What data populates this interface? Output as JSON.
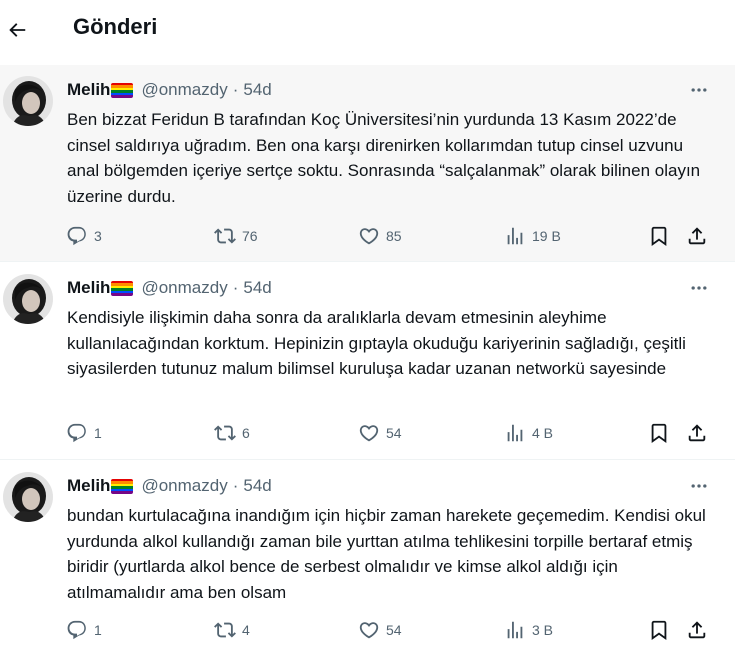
{
  "header": {
    "title": "Gönderi",
    "back_icon": "arrow-left-icon"
  },
  "colors": {
    "text": "#0f1419",
    "muted": "#536471",
    "highlight_bg": "#f7f7f7",
    "divider": "#eff3f4"
  },
  "tweets": [
    {
      "name": "Melih",
      "handle": "@onmazdy",
      "time": "54d",
      "text": "Ben bizzat Feridun B tarafından Koç Üniversitesi’nin yurdunda 13 Kasım 2022’de cinsel saldırıya uğradım. Ben ona karşı direnirken kollarımdan tutup cinsel uzvunu anal bölgemden içeriye sertçe soktu. Sonrasında “salçalanmak” olarak bilinen olayın üzerine durdu.",
      "replies": "3",
      "retweets": "76",
      "likes": "85",
      "views": "19 B"
    },
    {
      "name": "Melih",
      "handle": "@onmazdy",
      "time": "54d",
      "text": "Kendisiyle ilişkimin daha sonra da aralıklarla devam etmesinin aleyhime kullanılacağından korktum. Hepinizin gıptayla okuduğu kariyerinin sağladığı, çeşitli siyasilerden tutunuz malum bilimsel kuruluşa kadar uzanan networkü sayesinde",
      "replies": "1",
      "retweets": "6",
      "likes": "54",
      "views": "4 B"
    },
    {
      "name": "Melih",
      "handle": "@onmazdy",
      "time": "54d",
      "text": "bundan kurtulacağına inandığım için hiçbir zaman harekete geçemedim. Kendisi okul yurdunda alkol kullandığı zaman bile yurttan atılma tehlikesini torpille bertaraf etmiş biridir (yurtlarda alkol bence de serbest olmalıdır ve kimse alkol aldığı için atılmamalıdır ama ben olsam",
      "replies": "1",
      "retweets": "4",
      "likes": "54",
      "views": "3 B"
    }
  ]
}
